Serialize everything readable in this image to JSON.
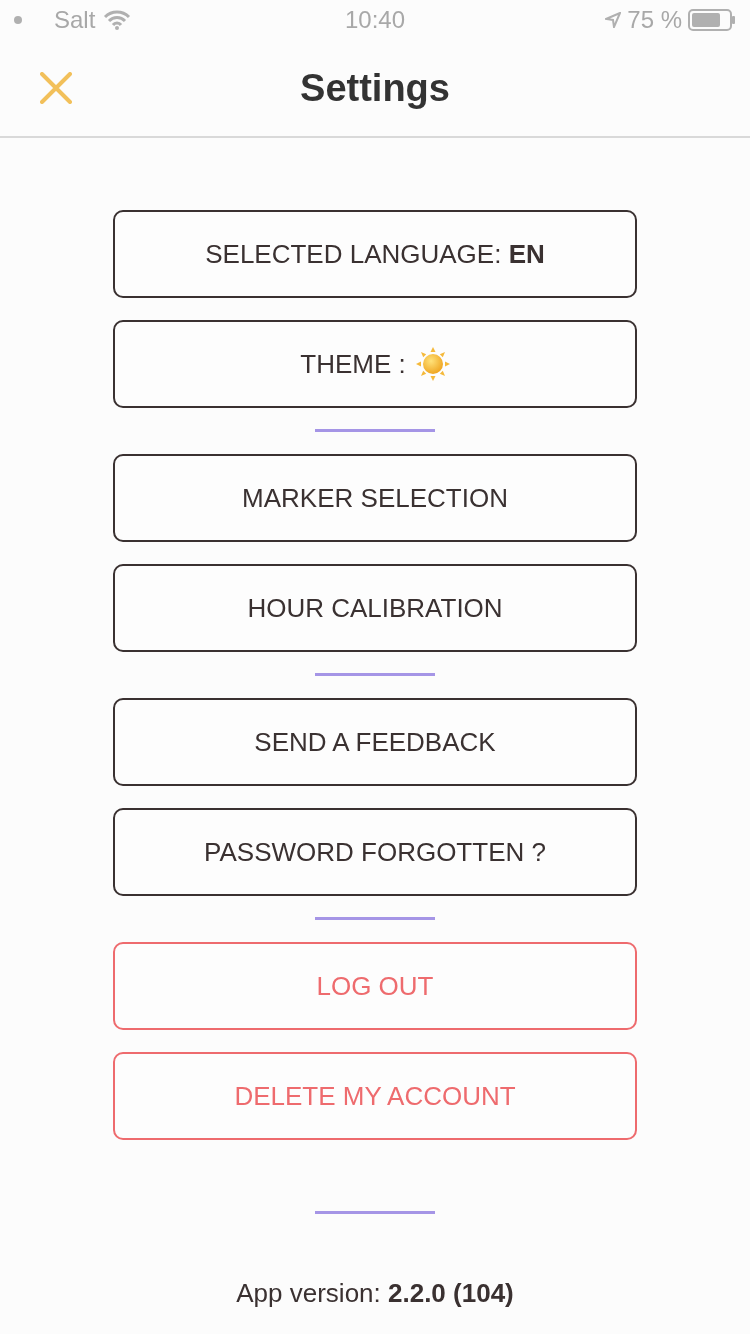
{
  "status_bar": {
    "carrier": "Salt",
    "time": "10:40",
    "battery": "75 %"
  },
  "header": {
    "title": "Settings"
  },
  "groups": [
    {
      "buttons": [
        {
          "label": "SELECTED LANGUAGE: **EN**",
          "kind": "text",
          "danger": false
        },
        {
          "label": "THEME :",
          "kind": "theme",
          "danger": false
        }
      ]
    },
    {
      "buttons": [
        {
          "label": "MARKER SELECTION",
          "kind": "text",
          "danger": false
        },
        {
          "label": "HOUR CALIBRATION",
          "kind": "text",
          "danger": false
        }
      ]
    },
    {
      "buttons": [
        {
          "label": "SEND A FEEDBACK",
          "kind": "text",
          "danger": false
        },
        {
          "label": "PASSWORD FORGOTTEN ?",
          "kind": "text",
          "danger": false
        }
      ]
    },
    {
      "buttons": [
        {
          "label": "LOG OUT",
          "kind": "text",
          "danger": true
        },
        {
          "label": "DELETE MY ACCOUNT",
          "kind": "text",
          "danger": true
        }
      ]
    }
  ],
  "footer": {
    "version": "App version: **2.2.0 (104)**"
  }
}
